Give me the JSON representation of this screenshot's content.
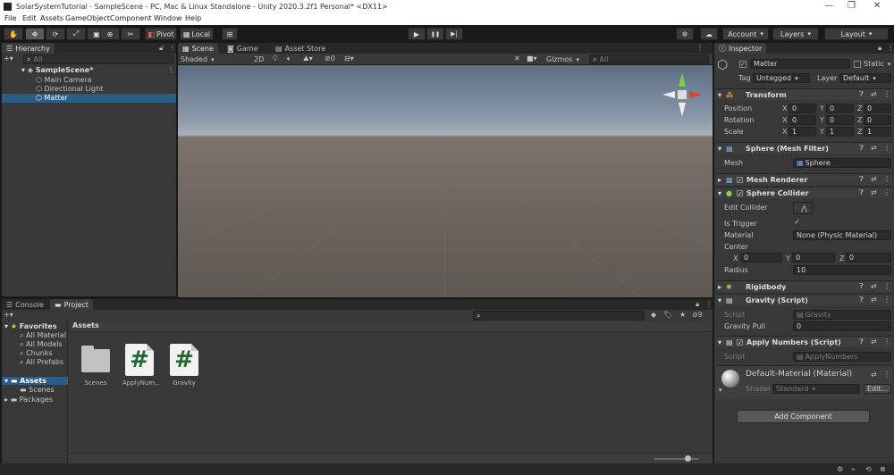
{
  "window": {
    "title": "SolarSystemTutorial - SampleScene - PC, Mac & Linux Standalone - Unity 2020.3.2f1 Personal* <DX11>",
    "minimize": "—",
    "maximize": "❐",
    "close": "✕"
  },
  "menu": [
    "File",
    "Edit",
    "Assets",
    "GameObject",
    "Component",
    "Window",
    "Help"
  ],
  "toolbar": {
    "pivot": "Pivot",
    "local": "Local",
    "account": "Account",
    "layers": "Layers",
    "layout": "Layout",
    "play": "▶",
    "pause": "❚❚",
    "step": "▶|"
  },
  "hierarchy": {
    "tab": "Hierarchy",
    "search": "All",
    "scene": "SampleScene*",
    "items": [
      "Main Camera",
      "Directional Light",
      "Matter"
    ]
  },
  "scene_tabs": [
    "Scene",
    "Game",
    "Asset Store"
  ],
  "scene_toolbar": {
    "shading": "Shaded",
    "mode": "2D",
    "gizmos": "Gizmos",
    "search": "All",
    "vis": "0"
  },
  "bottom": {
    "tabs": [
      "Console",
      "Project"
    ],
    "favorites": {
      "title": "Favorites",
      "items": [
        "All Material",
        "All Models",
        "Chunks",
        "All Prefabs"
      ]
    },
    "assets_tree": {
      "title": "Assets",
      "items": [
        "Scenes"
      ]
    },
    "packages": "Packages",
    "breadcrumb": "Assets",
    "count": "9",
    "assets": [
      {
        "name": "Scenes",
        "kind": "folder"
      },
      {
        "name": "ApplyNum...",
        "kind": "script"
      },
      {
        "name": "Gravity",
        "kind": "script"
      }
    ]
  },
  "inspector": {
    "tab": "Inspector",
    "object_name": "Matter",
    "static_label": "Static",
    "tag_label": "Tag",
    "tag": "Untagged",
    "layer_label": "Layer",
    "layer": "Default",
    "transform": {
      "title": "Transform",
      "rows": [
        {
          "label": "Position",
          "x": "0",
          "y": "0",
          "z": "0"
        },
        {
          "label": "Rotation",
          "x": "0",
          "y": "0",
          "z": "0"
        },
        {
          "label": "Scale",
          "x": "1",
          "y": "1",
          "z": "1"
        }
      ]
    },
    "mesh_filter": {
      "title": "Sphere (Mesh Filter)",
      "mesh_label": "Mesh",
      "mesh": "Sphere"
    },
    "mesh_renderer": {
      "title": "Mesh Renderer"
    },
    "sphere_collider": {
      "title": "Sphere Collider",
      "edit_collider": "Edit Collider",
      "is_trigger": "Is Trigger",
      "material_label": "Material",
      "material": "None (Physic Material)",
      "center_label": "Center",
      "cx": "0",
      "cy": "0",
      "cz": "0",
      "radius_label": "Radius",
      "radius": "10"
    },
    "rigidbody": {
      "title": "Rigidbody"
    },
    "gravity_script": {
      "title": "Gravity (Script)",
      "script_label": "Script",
      "script": "Gravity",
      "pull_label": "Gravity Pull",
      "pull": "0"
    },
    "apply_numbers": {
      "title": "Apply Numbers (Script)",
      "script_label": "Script",
      "script": "ApplyNumbers"
    },
    "material": {
      "title": "Default-Material (Material)",
      "shader_label": "Shader",
      "shader": "Standard",
      "edit": "Edit..."
    },
    "add_component": "Add Component"
  },
  "axes": {
    "x": "X",
    "y": "Y",
    "z": "Z"
  }
}
